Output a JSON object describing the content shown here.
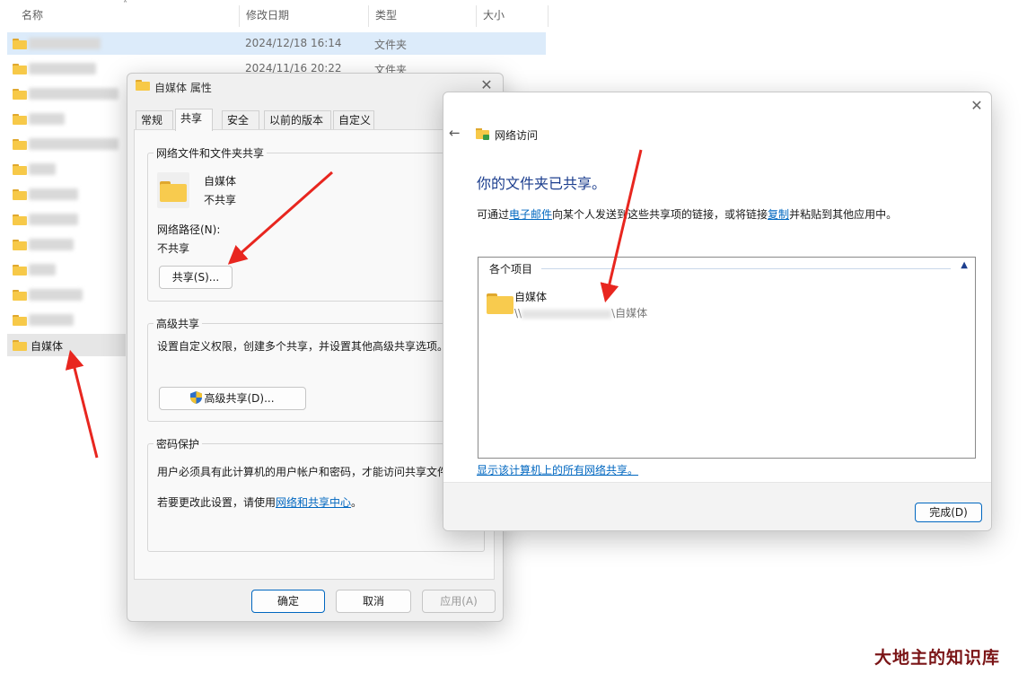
{
  "explorer": {
    "columns": [
      "名称",
      "修改日期",
      "类型",
      "大小"
    ],
    "rows": [
      {
        "date": "2024/12/18 16:14",
        "type": "文件夹"
      },
      {
        "date": "2024/11/16 20:22",
        "type": "文件夹"
      }
    ],
    "visible_folder": "自媒体"
  },
  "props": {
    "title": "自媒体 属性",
    "tabs": [
      "常规",
      "共享",
      "安全",
      "以前的版本",
      "自定义"
    ],
    "active_tab": "共享",
    "network_share_section": "网络文件和文件夹共享",
    "folder_name": "自媒体",
    "folder_status": "不共享",
    "network_path_label": "网络路径(N):",
    "network_path_value": "不共享",
    "share_button": "共享(S)...",
    "advanced_section": "高级共享",
    "advanced_desc": "设置自定义权限，创建多个共享，并设置其他高级共享选项。",
    "advanced_button": "高级共享(D)...",
    "password_section": "密码保护",
    "password_desc": "用户必须具有此计算机的用户帐户和密码，才能访问共享文件",
    "password_change_prefix": "若要更改此设置，请使用",
    "password_change_link": "网络和共享中心",
    "password_change_suffix": "。",
    "ok_button": "确定",
    "cancel_button": "取消",
    "apply_button": "应用(A)"
  },
  "net": {
    "title": "网络访问",
    "heading": "你的文件夹已共享。",
    "desc_prefix": "可通过",
    "desc_link_email": "电子邮件",
    "desc_middle": "向某个人发送到这些共享项的链接，或将链接",
    "desc_link_copy": "复制",
    "desc_suffix": "并粘贴到其他应用中。",
    "items_group_label": "各个项目",
    "item_name": "自媒体",
    "item_path_prefix": "\\\\",
    "item_path_suffix": "\\自媒体",
    "show_all_link": "显示该计算机上的所有网络共享。",
    "done_button": "完成(D)"
  },
  "watermark": "大地主的知识库",
  "colors": {
    "accent": "#0067c0",
    "annotation": "#e8261f",
    "heading": "#1c3e8e",
    "selection": "#dcebfa"
  }
}
